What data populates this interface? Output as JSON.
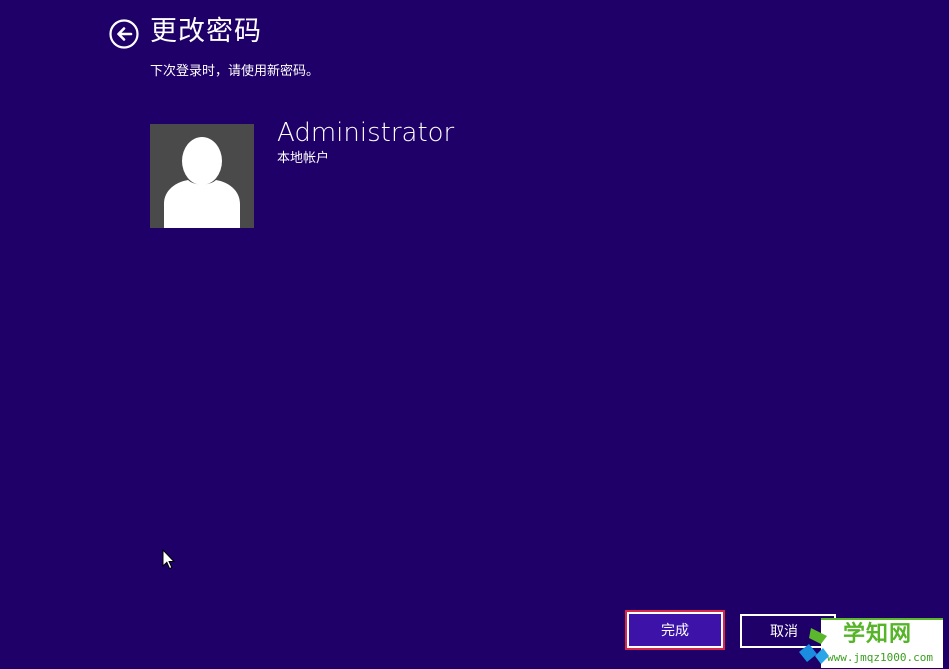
{
  "header": {
    "title": "更改密码",
    "subtitle": "下次登录时，请使用新密码。"
  },
  "account": {
    "name": "Administrator",
    "type": "本地帐户"
  },
  "buttons": {
    "done_label": "完成",
    "cancel_label": "取消"
  },
  "watermark": {
    "title": "学知网",
    "url": "www.jmqz1000.com"
  },
  "colors": {
    "background": "#1f0068",
    "avatar_bg": "#4a4a4a",
    "focus_outline": "#d8264a",
    "done_button_bg": "#3c12a8",
    "watermark_green": "#55b428"
  },
  "icons": {
    "back": "back-arrow-circle-icon",
    "avatar": "user-silhouette-icon",
    "cursor": "mouse-pointer-icon"
  }
}
